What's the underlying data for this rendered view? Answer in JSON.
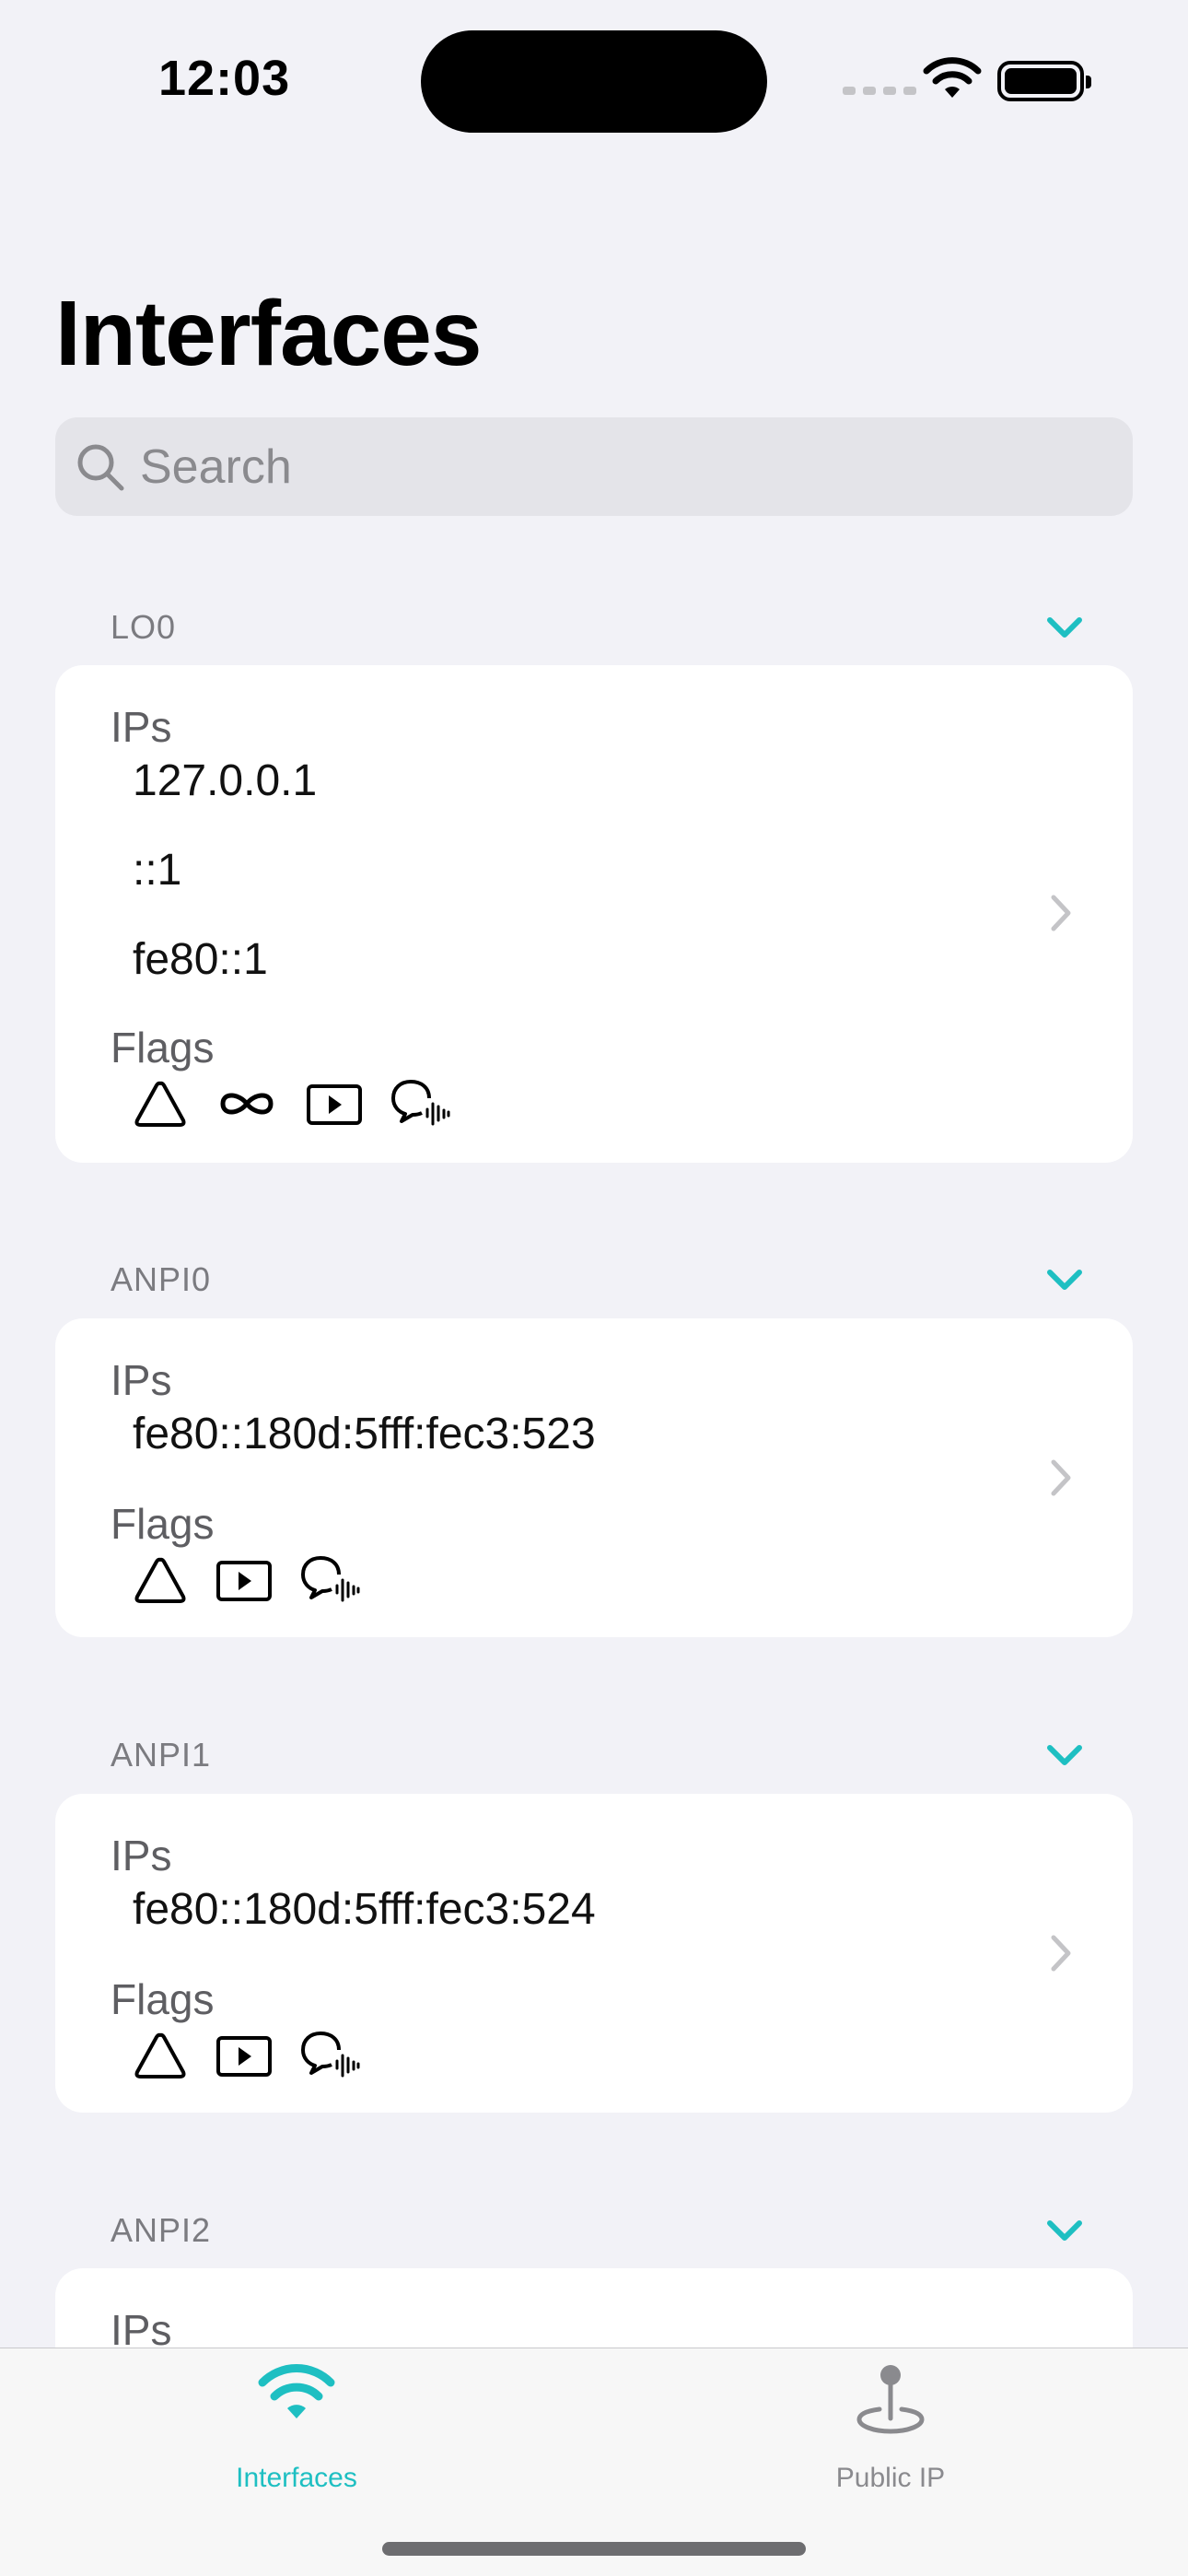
{
  "status_bar": {
    "time": "12:03"
  },
  "header": {
    "title": "Interfaces"
  },
  "search": {
    "placeholder": "Search",
    "value": ""
  },
  "sections": [
    {
      "name": "LO0",
      "ips_label": "IPs",
      "ips": [
        "127.0.0.1",
        "::1",
        "fe80::1"
      ],
      "flags_label": "Flags",
      "flag_icons": [
        "triangle-icon",
        "infinity-icon",
        "play-rectangle-icon",
        "bubble-waveform-icon"
      ]
    },
    {
      "name": "ANPI0",
      "ips_label": "IPs",
      "ips": [
        "fe80::180d:5fff:fec3:523"
      ],
      "flags_label": "Flags",
      "flag_icons": [
        "triangle-icon",
        "play-rectangle-icon",
        "bubble-waveform-icon"
      ]
    },
    {
      "name": "ANPI1",
      "ips_label": "IPs",
      "ips": [
        "fe80::180d:5fff:fec3:524"
      ],
      "flags_label": "Flags",
      "flag_icons": [
        "triangle-icon",
        "play-rectangle-icon",
        "bubble-waveform-icon"
      ]
    },
    {
      "name": "ANPI2",
      "ips_label": "IPs"
    }
  ],
  "tab_bar": {
    "tabs": [
      {
        "label": "Interfaces",
        "icon": "wifi-icon",
        "selected": true
      },
      {
        "label": "Public IP",
        "icon": "map-pin-icon",
        "selected": false
      }
    ]
  },
  "colors": {
    "accent": "#1ebfc2",
    "background": "#f2f2f7",
    "card": "#ffffff",
    "secondary_text": "#7b7b80",
    "chevron": "#c4c4c7"
  }
}
